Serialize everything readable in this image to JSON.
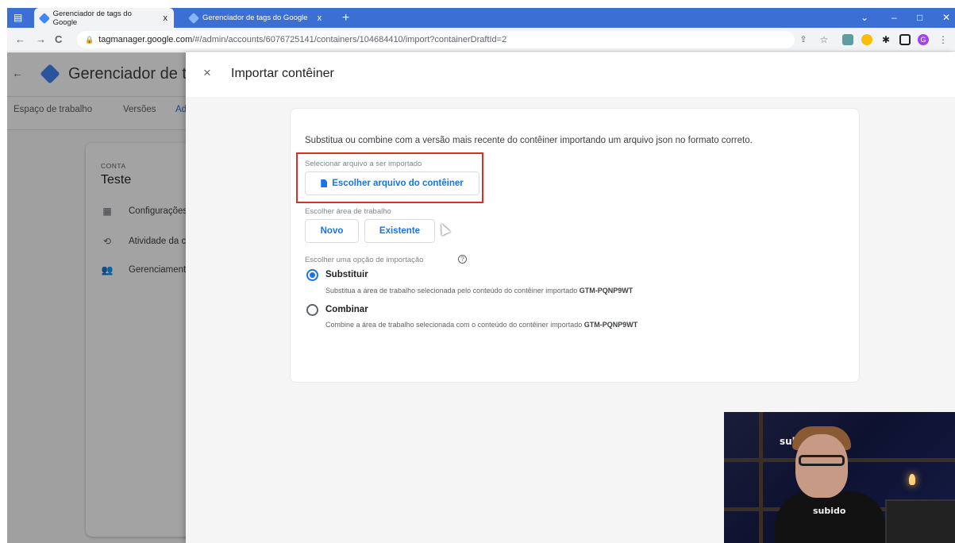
{
  "browser": {
    "tabs": [
      {
        "title": "Gerenciador de tags do Google",
        "active": true
      },
      {
        "title": "Gerenciador de tags do Google",
        "active": false
      }
    ],
    "new_tab_label": "+",
    "tab_close_label": "x",
    "url_host": "tagmanager.google.com",
    "url_path": "/#/admin/accounts/6076725141/containers/104684410/import?containerDraftId=2",
    "profile_initial": "G",
    "nav": {
      "back": "←",
      "forward": "→",
      "reload": "C"
    },
    "window_controls": {
      "minimize": "–",
      "maximize": "□",
      "close": "✕",
      "menu": "⌄"
    }
  },
  "app": {
    "back_arrow": "←",
    "title": "Gerenciador de tags do Google",
    "nav_tabs": [
      "Espaço de trabalho",
      "Versões",
      "Administrador"
    ],
    "selected_tab": 2,
    "account": {
      "label": "CONTA",
      "name": "Teste",
      "items": [
        {
          "icon": "building-icon",
          "label": "Configurações da conta"
        },
        {
          "icon": "history-icon",
          "label": "Atividade da conta"
        },
        {
          "icon": "people-icon",
          "label": "Gerenciamento de usuários"
        }
      ]
    }
  },
  "panel": {
    "close_label": "×",
    "title": "Importar contêiner",
    "intro": "Substitua ou combine com a versão mais recente do contêiner importando um arquivo json no formato correto.",
    "file_label": "Selecionar arquivo a ser importado",
    "file_button": "Escolher arquivo do contêiner",
    "workspace_label": "Escolher área de trabalho",
    "workspace_buttons": [
      "Novo",
      "Existente"
    ],
    "import_option_label": "Escolher uma opção de importação",
    "help_label": "?",
    "options": [
      {
        "title": "Substituir",
        "desc": "Substitua a área de trabalho selecionada pelo conteúdo do contêiner importado",
        "container_id": "GTM-PQNP9WT",
        "selected": true
      },
      {
        "title": "Combinar",
        "desc": "Combine a área de trabalho selecionada com o conteúdo do contêiner importado",
        "container_id": "GTM-PQNP9WT",
        "selected": false
      }
    ]
  },
  "webcam": {
    "wall_text": "subido",
    "shirt_text": "subido"
  },
  "colors": {
    "accent": "#1a73e8",
    "highlight_box": "#d93025",
    "tabbar": "#3b6fd4"
  }
}
